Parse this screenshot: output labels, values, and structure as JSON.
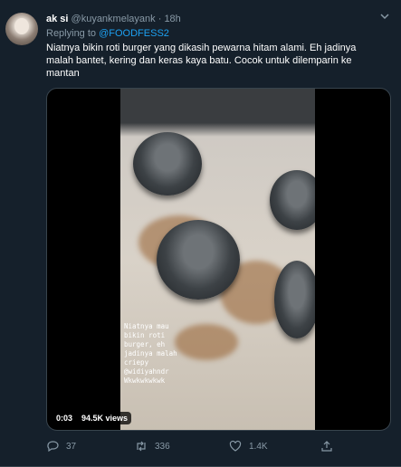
{
  "tweet": {
    "name": "ak si",
    "handle": "@kuyankmelayank",
    "dot": "·",
    "time": "18h",
    "reply_prefix": "Replying to",
    "reply_to": "@FOODFESS2",
    "text": "Niatnya bikin roti burger yang dikasih pewarna hitam alami. Eh jadinya malah bantet, kering dan keras kaya batu. Cocok untuk dilemparin ke mantan"
  },
  "media": {
    "overlay_text": "Niatnya mau\nbikin roti\nburger, eh\njadinya malah\ncriepy\n@widiyahndr\nWkwkwkwkwk",
    "duration": "0:03",
    "views": "94.5K views"
  },
  "actions": {
    "replies": "37",
    "retweets": "336",
    "likes": "1.4K"
  },
  "icons": [
    "avatar",
    "chevron-down-icon",
    "reply-icon",
    "retweet-icon",
    "like-icon",
    "share-icon"
  ]
}
